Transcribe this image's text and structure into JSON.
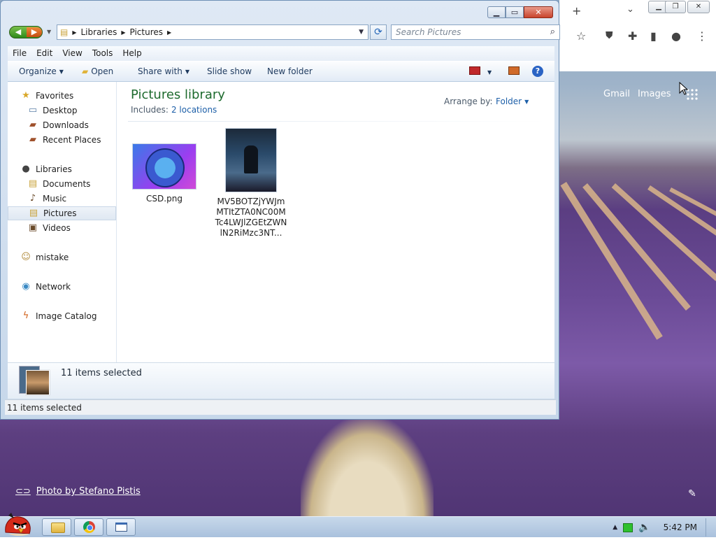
{
  "explorer": {
    "breadcrumb": [
      "Libraries",
      "Pictures"
    ],
    "search_placeholder": "Search Pictures",
    "menu": [
      "File",
      "Edit",
      "View",
      "Tools",
      "Help"
    ],
    "toolbar": {
      "organize": "Organize",
      "open": "Open",
      "share_with": "Share with",
      "slide_show": "Slide show",
      "new_folder": "New folder"
    },
    "nav": {
      "favorites": "Favorites",
      "desktop": "Desktop",
      "downloads": "Downloads",
      "recent_places": "Recent Places",
      "libraries": "Libraries",
      "documents": "Documents",
      "music": "Music",
      "pictures": "Pictures",
      "videos": "Videos",
      "mistake": "mistake",
      "network": "Network",
      "image_catalog": "Image Catalog"
    },
    "library": {
      "title": "Pictures library",
      "includes_label": "Includes:",
      "includes_link": "2 locations",
      "arrange_label": "Arrange by:",
      "arrange_value": "Folder"
    },
    "files": [
      {
        "name": "CSD.png"
      },
      {
        "name": "MV5BOTZjYWJmMTItZTA0NC00MTc4LWJlZGEtZWNlN2RiMzc3NT..."
      }
    ],
    "details_text": "11 items selected",
    "status_text": "11 items selected"
  },
  "chrome": {
    "gmail": "Gmail",
    "images": "Images",
    "photo_credit": "Photo by Stefano Pistis"
  },
  "taskbar": {
    "clock": "5:42 PM"
  }
}
